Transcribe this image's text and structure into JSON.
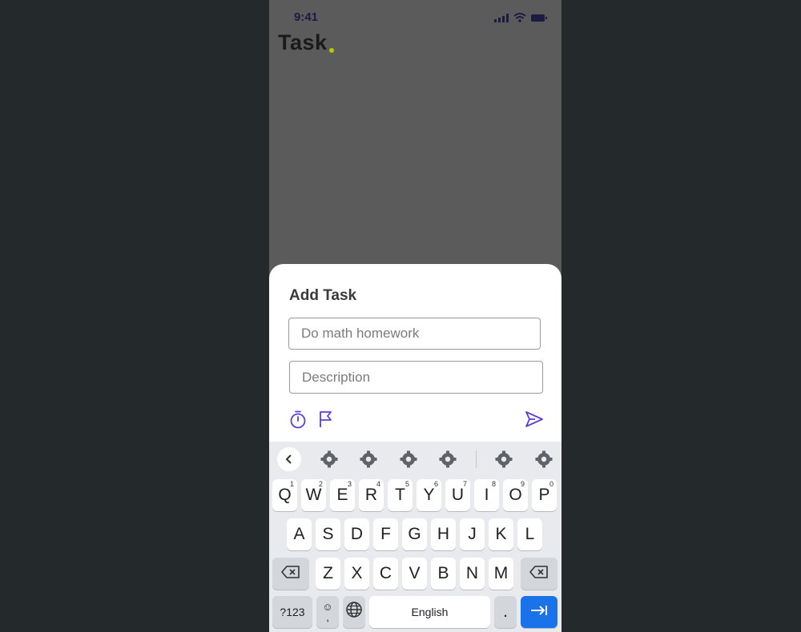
{
  "status": {
    "time": "9:41"
  },
  "app": {
    "title": "Task"
  },
  "sheet": {
    "title": "Add Task",
    "title_placeholder": "Do math homework",
    "description_placeholder": "Description"
  },
  "keyboard": {
    "row1": [
      {
        "label": "Q",
        "hint": "1"
      },
      {
        "label": "W",
        "hint": "2"
      },
      {
        "label": "E",
        "hint": "3"
      },
      {
        "label": "R",
        "hint": "4"
      },
      {
        "label": "T",
        "hint": "5"
      },
      {
        "label": "Y",
        "hint": "6"
      },
      {
        "label": "U",
        "hint": "7"
      },
      {
        "label": "I",
        "hint": "8"
      },
      {
        "label": "O",
        "hint": "9"
      },
      {
        "label": "P",
        "hint": "0"
      }
    ],
    "row2": [
      "A",
      "S",
      "D",
      "F",
      "G",
      "H",
      "J",
      "K",
      "L"
    ],
    "row3": [
      "Z",
      "X",
      "C",
      "V",
      "B",
      "N",
      "M"
    ],
    "symbols_label": "?123",
    "emoji_label": "☺",
    "comma_label": ",",
    "space_label": "English",
    "period_label": "."
  },
  "colors": {
    "accent": "#5b3fd6",
    "keyboard_blue": "#1a73e8",
    "overlay": "#5b5b5b"
  }
}
